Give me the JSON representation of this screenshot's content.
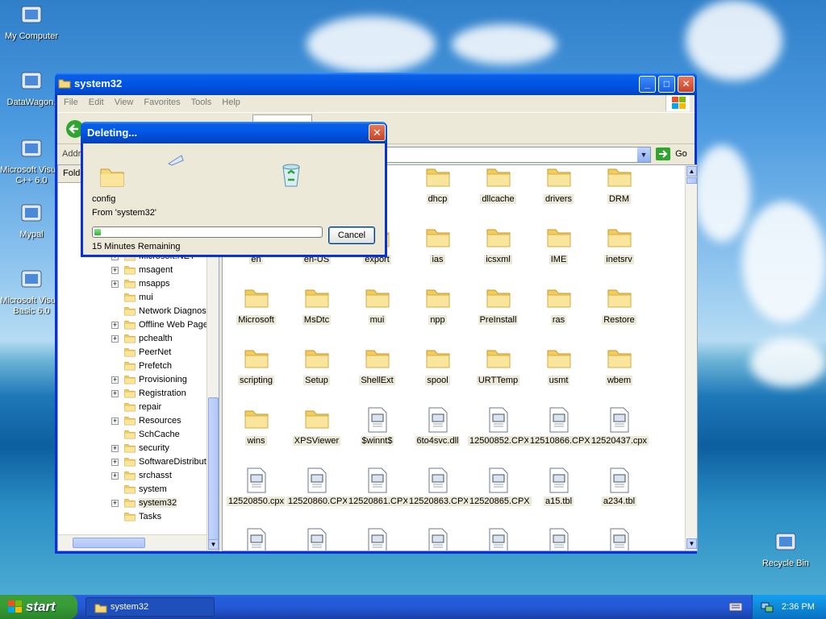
{
  "desktop": {
    "icons": [
      {
        "label": "My Computer"
      },
      {
        "label": "DataWagon."
      },
      {
        "label": "Microsoft Visual C++ 6.0"
      },
      {
        "label": "Mypal"
      },
      {
        "label": "Microsoft Visual Basic 6.0"
      },
      {
        "label": "Recycle Bin"
      }
    ]
  },
  "window": {
    "title": "system32",
    "menu": [
      "File",
      "Edit",
      "View",
      "Favorites",
      "Tools",
      "Help"
    ],
    "address_label": "Address",
    "go_label": "Go",
    "folders_label": "Folders",
    "tree": [
      {
        "label": "Media",
        "expand": ""
      },
      {
        "label": "Microsoft.NET",
        "expand": "+"
      },
      {
        "label": "msagent",
        "expand": "+"
      },
      {
        "label": "msapps",
        "expand": "+"
      },
      {
        "label": "mui",
        "expand": ""
      },
      {
        "label": "Network Diagnostic",
        "expand": ""
      },
      {
        "label": "Offline Web Pages",
        "expand": "+"
      },
      {
        "label": "pchealth",
        "expand": "+"
      },
      {
        "label": "PeerNet",
        "expand": ""
      },
      {
        "label": "Prefetch",
        "expand": ""
      },
      {
        "label": "Provisioning",
        "expand": "+"
      },
      {
        "label": "Registration",
        "expand": "+"
      },
      {
        "label": "repair",
        "expand": ""
      },
      {
        "label": "Resources",
        "expand": "+"
      },
      {
        "label": "SchCache",
        "expand": ""
      },
      {
        "label": "security",
        "expand": "+"
      },
      {
        "label": "SoftwareDistribution",
        "expand": "+"
      },
      {
        "label": "srchasst",
        "expand": "+"
      },
      {
        "label": "system",
        "expand": ""
      },
      {
        "label": "system32",
        "expand": "+"
      },
      {
        "label": "Tasks",
        "expand": ""
      }
    ],
    "files": [
      {
        "label": "dhcp",
        "kind": "folder"
      },
      {
        "label": "dllcache",
        "kind": "folder"
      },
      {
        "label": "drivers",
        "kind": "folder"
      },
      {
        "label": "DRM",
        "kind": "folder"
      },
      {
        "label": "en",
        "kind": "folder"
      },
      {
        "label": "en-US",
        "kind": "folder"
      },
      {
        "label": "export",
        "kind": "folder"
      },
      {
        "label": "ias",
        "kind": "folder"
      },
      {
        "label": "icsxml",
        "kind": "folder"
      },
      {
        "label": "IME",
        "kind": "folder"
      },
      {
        "label": "inetsrv",
        "kind": "folder"
      },
      {
        "label": "Microsoft",
        "kind": "folder"
      },
      {
        "label": "MsDtc",
        "kind": "folder"
      },
      {
        "label": "mui",
        "kind": "folder"
      },
      {
        "label": "npp",
        "kind": "folder"
      },
      {
        "label": "PreInstall",
        "kind": "folder"
      },
      {
        "label": "ras",
        "kind": "folder"
      },
      {
        "label": "Restore",
        "kind": "folder"
      },
      {
        "label": "scripting",
        "kind": "folder"
      },
      {
        "label": "Setup",
        "kind": "folder"
      },
      {
        "label": "ShellExt",
        "kind": "folder"
      },
      {
        "label": "spool",
        "kind": "folder"
      },
      {
        "label": "URTTemp",
        "kind": "folder"
      },
      {
        "label": "usmt",
        "kind": "folder"
      },
      {
        "label": "wbem",
        "kind": "folder"
      },
      {
        "label": "wins",
        "kind": "folder"
      },
      {
        "label": "XPSViewer",
        "kind": "folder"
      },
      {
        "label": "$winnt$",
        "kind": "file"
      },
      {
        "label": "6to4svc.dll",
        "kind": "file"
      },
      {
        "label": "12500852.CPX",
        "kind": "file"
      },
      {
        "label": "12510866.CPX",
        "kind": "file"
      },
      {
        "label": "12520437.cpx",
        "kind": "file"
      },
      {
        "label": "12520850.cpx",
        "kind": "file"
      },
      {
        "label": "12520860.CPX",
        "kind": "file"
      },
      {
        "label": "12520861.CPX",
        "kind": "file"
      },
      {
        "label": "12520863.CPX",
        "kind": "file"
      },
      {
        "label": "12520865.CPX",
        "kind": "file"
      },
      {
        "label": "a15.tbl",
        "kind": "file"
      },
      {
        "label": "a234.tbl",
        "kind": "file"
      }
    ]
  },
  "dialog": {
    "title": "Deleting...",
    "item": "config",
    "from": "From 'system32'",
    "remaining": "15 Minutes Remaining",
    "cancel": "Cancel",
    "progress": 0.03
  },
  "taskbar": {
    "start": "start",
    "task": "system32",
    "clock": "2:36 PM"
  },
  "colors": {
    "accent": "#0055e5",
    "start": "#379e37",
    "folder": "#f5d77c"
  }
}
